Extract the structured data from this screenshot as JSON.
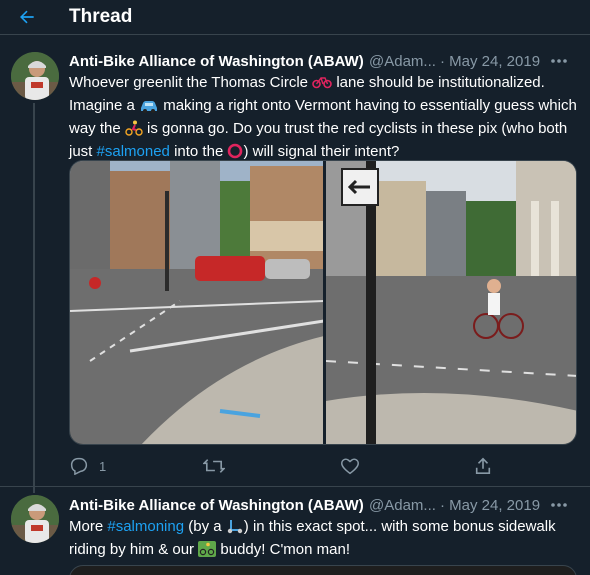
{
  "header": {
    "title": "Thread"
  },
  "tweets": [
    {
      "name": "Anti-Bike Alliance of Washington (ABAW)",
      "handle": "@Adam...",
      "date": "· May 24, 2019",
      "text_1": "Whoever greenlit the Thomas Circle",
      "text_2": "lane should be institutionalized.",
      "text_3": "Imagine a",
      "text_4": "making a right onto Vermont having to essentially guess which",
      "text_5": "way the",
      "text_6": "is gonna go. Do you trust the red cyclists in these pix (who both",
      "text_7": "just",
      "hashtag": "#salmoned",
      "text_8": "into the",
      "text_9": ") will signal their intent?",
      "reply_count": "1",
      "retweet_count": "",
      "like_count": ""
    },
    {
      "name": "Anti-Bike Alliance of Washington (ABAW)",
      "handle": "@Adam...",
      "date": "· May 24, 2019",
      "text_1": "More",
      "hashtag": "#salmoning",
      "text_2": "(by a",
      "text_3": ") in this exact spot... with some bonus sidewalk",
      "text_4": "riding by him & our",
      "text_5": "buddy! C'mon man!"
    }
  ],
  "colors": {
    "background": "#15202b",
    "accent": "#1da1f2",
    "muted": "#8899a6",
    "border": "#38444d"
  },
  "icons": {
    "back": "arrow-left-icon",
    "more": "more-horizontal-icon",
    "reply": "reply-icon",
    "retweet": "retweet-icon",
    "like": "heart-icon",
    "share": "share-icon"
  }
}
